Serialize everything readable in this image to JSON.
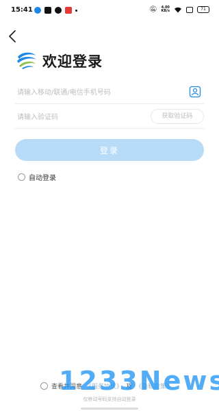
{
  "status_bar": {
    "time": "15:41",
    "speed_value": "4.00",
    "speed_unit": "KB/s",
    "battery": "71"
  },
  "header": {
    "title": "欢迎登录",
    "logo_icon": "china-mobile-logo-icon"
  },
  "form": {
    "phone_placeholder": "请输入移动/联通/电信手机号码",
    "code_placeholder": "请输入验证码",
    "get_code_label": "获取验证码",
    "login_label": "登录",
    "auto_login_label": "自动登录"
  },
  "agreement": {
    "prefix": "查看并同意",
    "link_service": "《服务协议》",
    "conjunction": "及",
    "link_privacy": "《隐私政策》",
    "note": "仅移动号码支持自动登录"
  },
  "watermark": "1233News",
  "colors": {
    "button_disabled": "#b8dcf8",
    "link": "#9bb7cc",
    "brand_blue": "#1e88e5",
    "brand_green": "#8bc34a"
  }
}
